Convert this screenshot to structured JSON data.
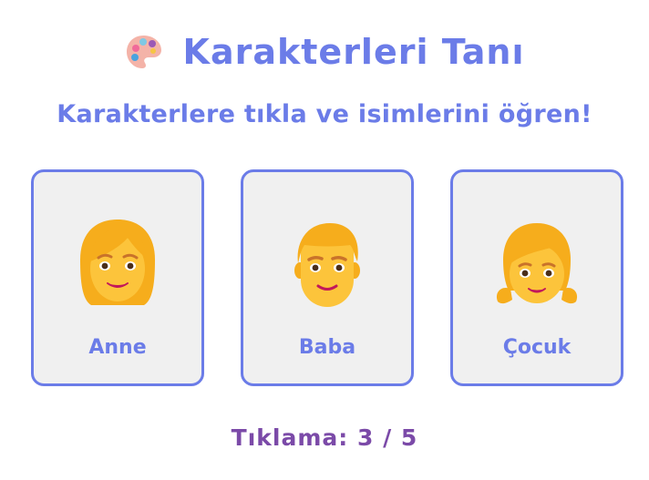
{
  "header": {
    "title": "Karakterleri Tanı",
    "icon": "palette-icon"
  },
  "subtitle": "Karakterlere tıkla ve isimlerini öğren!",
  "characters": [
    {
      "name": "Anne",
      "icon": "woman-face-icon"
    },
    {
      "name": "Baba",
      "icon": "man-face-icon"
    },
    {
      "name": "Çocuk",
      "icon": "child-face-icon"
    }
  ],
  "counter": {
    "label": "Tıklama:",
    "current": 3,
    "total": 5,
    "text": "Tıklama: 3 / 5"
  },
  "colors": {
    "accent": "#6b7ce8",
    "counter": "#7b4aa8",
    "card_background": "#f0f0f0",
    "hair": "#f6ad1c",
    "skin": "#fcc43b"
  }
}
